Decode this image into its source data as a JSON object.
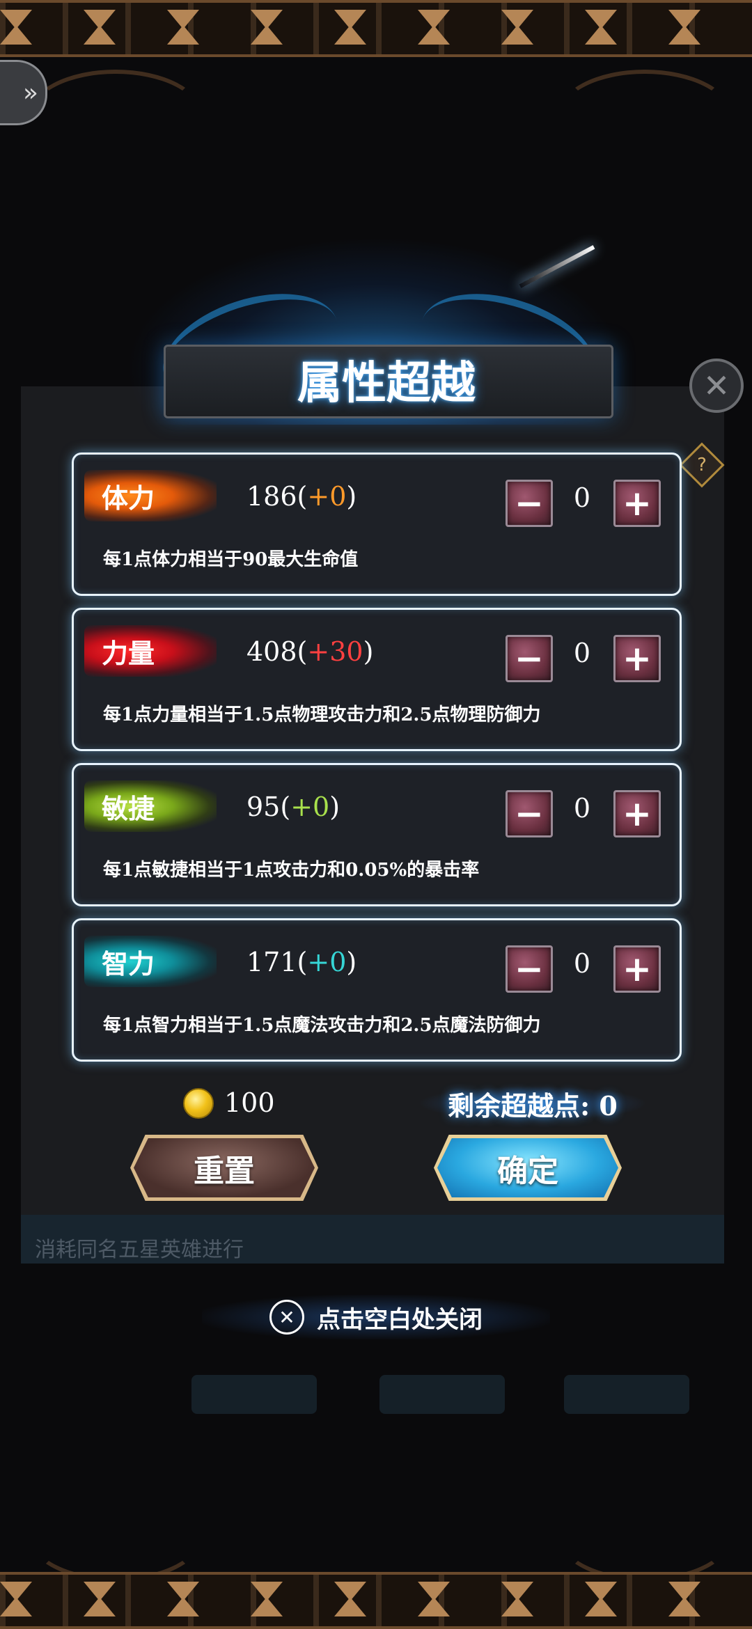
{
  "dialog": {
    "title": "属性超越",
    "close_hint": "点击空白处关闭"
  },
  "attributes": [
    {
      "label": "体力",
      "base": "186",
      "bonus": "+0",
      "allocated": "0",
      "desc": "每1点体力相当于90最大生命值",
      "color": "#ff8a1c"
    },
    {
      "label": "力量",
      "base": "408",
      "bonus": "+30",
      "allocated": "0",
      "desc": "每1点力量相当于1.5点物理攻击力和2.5点物理防御力",
      "color": "#ff2a2a"
    },
    {
      "label": "敏捷",
      "base": "95",
      "bonus": "+0",
      "allocated": "0",
      "desc": "每1点敏捷相当于1点攻击力和0.05%的暴击率",
      "color": "#b8e044"
    },
    {
      "label": "智力",
      "base": "171",
      "bonus": "+0",
      "allocated": "0",
      "desc": "每1点智力相当于1.5点魔法攻击力和2.5点魔法防御力",
      "color": "#20d0d0"
    }
  ],
  "stepper": {
    "minus": "−",
    "plus": "+"
  },
  "footer": {
    "coin_icon": "gold-coin-icon",
    "coin_amount": "100",
    "remaining_label": "剩余超越点: 0",
    "reset_label": "重置",
    "confirm_label": "确定"
  },
  "background": {
    "strip_text": "消耗同名五星英雄进行"
  }
}
